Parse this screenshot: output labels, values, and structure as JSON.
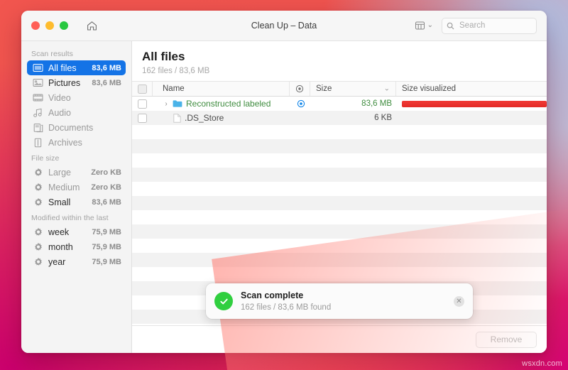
{
  "window": {
    "title": "Clean Up – Data",
    "home_icon": "home-icon",
    "traffic": {
      "close": "close-button",
      "minimize": "minimize-button",
      "zoom": "zoom-button"
    },
    "view_icon": "grid-view-icon",
    "view_chevron": "⌄",
    "search": {
      "placeholder": "Search",
      "value": "",
      "icon": "search-icon"
    }
  },
  "sidebar": {
    "groups": [
      {
        "title": "Scan results",
        "items": [
          {
            "label": "All files",
            "size": "83,6 MB",
            "icon": "all-files-icon",
            "selected": true,
            "dim": false
          },
          {
            "label": "Pictures",
            "size": "83,6 MB",
            "icon": "pictures-icon",
            "selected": false,
            "dim": false
          },
          {
            "label": "Video",
            "size": "",
            "icon": "video-icon",
            "selected": false,
            "dim": true
          },
          {
            "label": "Audio",
            "size": "",
            "icon": "audio-icon",
            "selected": false,
            "dim": true
          },
          {
            "label": "Documents",
            "size": "",
            "icon": "documents-icon",
            "selected": false,
            "dim": true
          },
          {
            "label": "Archives",
            "size": "",
            "icon": "archives-icon",
            "selected": false,
            "dim": true
          }
        ]
      },
      {
        "title": "File size",
        "items": [
          {
            "label": "Large",
            "size": "Zero KB",
            "icon": "gear-icon",
            "selected": false,
            "dim": true
          },
          {
            "label": "Medium",
            "size": "Zero KB",
            "icon": "gear-icon",
            "selected": false,
            "dim": true
          },
          {
            "label": "Small",
            "size": "83,6 MB",
            "icon": "gear-icon",
            "selected": false,
            "dim": false
          }
        ]
      },
      {
        "title": "Modified within the last",
        "items": [
          {
            "label": "week",
            "size": "75,9 MB",
            "icon": "gear-icon",
            "selected": false,
            "dim": false
          },
          {
            "label": "month",
            "size": "75,9 MB",
            "icon": "gear-icon",
            "selected": false,
            "dim": false
          },
          {
            "label": "year",
            "size": "75,9 MB",
            "icon": "gear-icon",
            "selected": false,
            "dim": false
          }
        ]
      }
    ]
  },
  "main": {
    "title": "All files",
    "subtitle": "162 files / 83,6 MB",
    "columns": {
      "select_all": "select-all-checkbox",
      "name": "Name",
      "target_icon": "reveal-target-icon",
      "size": "Size",
      "sort_caret": "⌄",
      "visualized": "Size visualized"
    },
    "rows": [
      {
        "checked": false,
        "expandable": true,
        "disclosure": "›",
        "icon": "folder-icon",
        "name": "Reconstructed labeled",
        "name_color": "green",
        "has_target": true,
        "size": "83,6 MB",
        "size_color": "green",
        "bar_percent": 100
      },
      {
        "checked": false,
        "expandable": false,
        "disclosure": "",
        "icon": "document-icon",
        "name": ".DS_Store",
        "name_color": "grey",
        "has_target": false,
        "size": "6 KB",
        "size_color": "grey",
        "bar_percent": 0
      }
    ],
    "empty_row_count": 15
  },
  "footer": {
    "remove_label": "Remove",
    "remove_enabled": false
  },
  "toast": {
    "icon": "success-check-icon",
    "title": "Scan complete",
    "subtitle": "162 files / 83,6 MB found",
    "close_icon": "✕"
  },
  "watermark": {
    "text": "wsxdn.com"
  },
  "colors": {
    "accent_selection": "#1473e6",
    "bar_red": "#e42a26",
    "success_green": "#30cf3f",
    "name_green": "#3f8c3f"
  }
}
